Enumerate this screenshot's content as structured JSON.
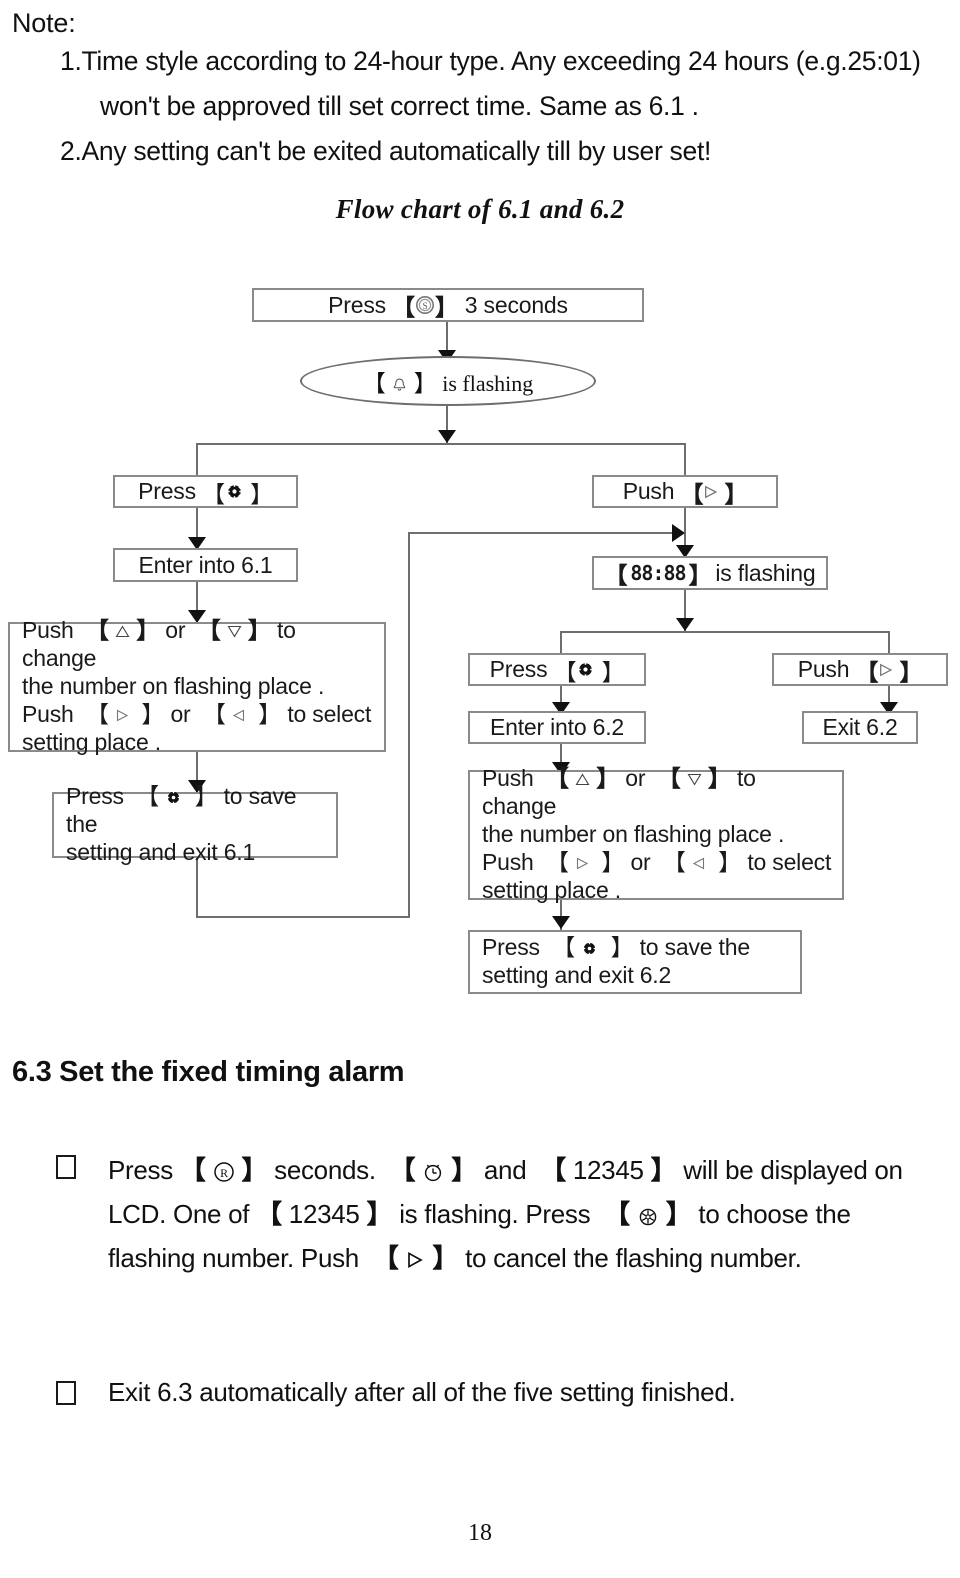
{
  "note": {
    "label": "Note:",
    "items": [
      "1.Time style according to 24-hour type. Any exceeding 24 hours (e.g.25:01)",
      "won't be approved till set correct time. Same as 6.1 .",
      "2.Any setting can't be exited automatically till by user set!"
    ]
  },
  "flow": {
    "title": "Flow chart of 6.1 and 6.2",
    "nodes": {
      "start": {
        "pre": "Press",
        "icon": "circled-s-icon",
        "post": "3 seconds"
      },
      "oval": {
        "icon": "bell-icon",
        "post": "is flashing"
      },
      "left_press": {
        "pre": "Press",
        "icon": "gear-icon"
      },
      "left_enter": {
        "label": "Enter into 6.1"
      },
      "left_instr": {
        "l1_a": "Push",
        "l1_icon1": "triangle-up-icon",
        "l1_b": "or",
        "l1_icon2": "triangle-down-icon",
        "l1_c": "to change",
        "l2": "the number on flashing place .",
        "l3_a": "Push",
        "l3_icon1": "triangle-right-icon",
        "l3_b": "or",
        "l3_icon2": "triangle-left-icon",
        "l3_c": "to select",
        "l4": "setting place ."
      },
      "left_save": {
        "l1_a": "Press",
        "l1_icon": "gear-icon",
        "l1_b": "to save the",
        "l2": "setting and exit 6.1"
      },
      "right_push": {
        "pre": "Push",
        "icon": "triangle-right-icon"
      },
      "right_flash": {
        "lcd": "88:88",
        "post": "is flashing"
      },
      "mid_press": {
        "pre": "Press",
        "icon": "gear-icon"
      },
      "mid_enter": {
        "label": "Enter into 6.2"
      },
      "mid_push": {
        "pre": "Push",
        "icon": "triangle-right-icon"
      },
      "mid_exit": {
        "label": "Exit 6.2"
      },
      "right_instr": {
        "l1_a": "Push",
        "l1_icon1": "triangle-up-icon",
        "l1_b": "or",
        "l1_icon2": "triangle-down-icon",
        "l1_c": "to change",
        "l2": "the number on flashing place .",
        "l3_a": "Push",
        "l3_icon1": "triangle-right-icon",
        "l3_b": "or",
        "l3_icon2": "triangle-left-icon",
        "l3_c": "to select",
        "l4": "setting place ."
      },
      "right_save": {
        "l1_a": "Press",
        "l1_icon": "gear-icon",
        "l1_b": "to save the",
        "l2": "setting and exit 6.2"
      }
    }
  },
  "section": {
    "heading": "6.3 Set the fixed timing alarm",
    "bullet1": {
      "l1_a": "Press",
      "l1_icon1": "circled-r-icon",
      "l1_b": "seconds.",
      "l1_icon2": "alarm-clock-icon",
      "l1_c": "and",
      "l1_val": "12345",
      "l1_d": "will be displayed on",
      "l2_a": "LCD. One of",
      "l2_val": "12345",
      "l2_b": "is flashing. Press",
      "l2_icon": "snowflake-icon",
      "l2_c": "to choose the",
      "l3_a": "flashing number. Push",
      "l3_icon": "triangle-right-boxed-icon",
      "l3_b": "to cancel the flashing number."
    },
    "bullet2": {
      "text": "Exit 6.3 automatically after all of the five setting finished."
    }
  },
  "footer": {
    "page_number": "18"
  },
  "colors": {
    "text": "#111111",
    "line": "#6e6e6e",
    "box_border": "#8a8a8a",
    "arrow": "#111111",
    "background": "#ffffff"
  }
}
